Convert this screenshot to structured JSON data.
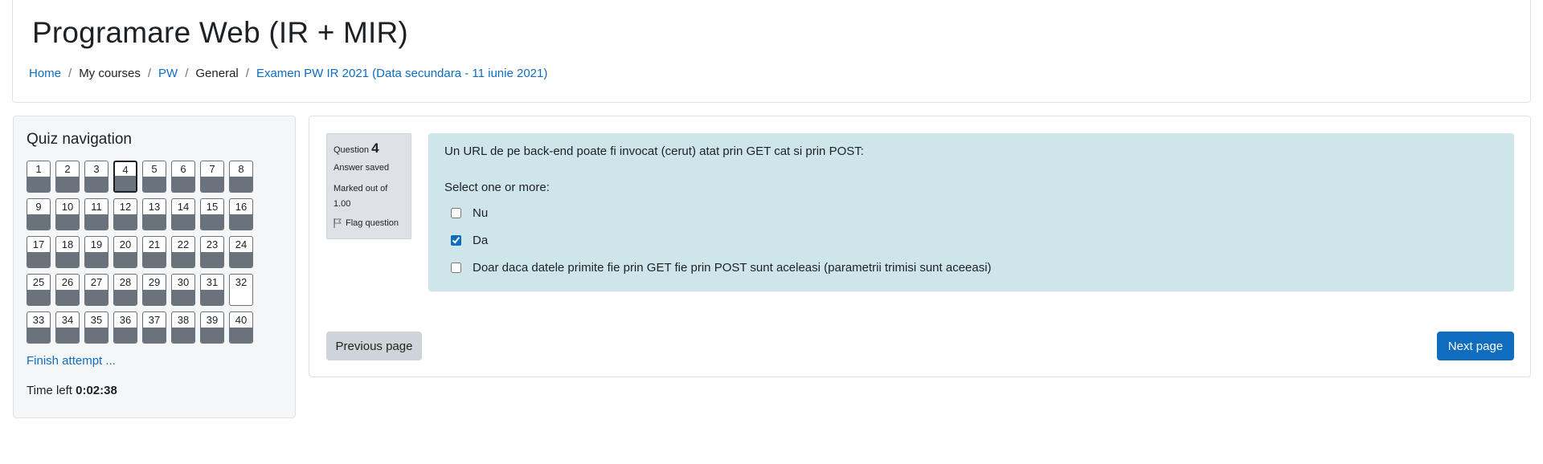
{
  "header": {
    "title": "Programare Web (IR + MIR)",
    "breadcrumb": [
      {
        "label": "Home",
        "link": true
      },
      {
        "label": "My courses",
        "link": false
      },
      {
        "label": "PW",
        "link": true
      },
      {
        "label": "General",
        "link": false
      },
      {
        "label": "Examen PW IR 2021 (Data secundara - 11 iunie 2021)",
        "link": true
      }
    ],
    "separator": "/"
  },
  "quiz_nav": {
    "title": "Quiz navigation",
    "current_question": 4,
    "questions": [
      {
        "n": "1",
        "answered": true
      },
      {
        "n": "2",
        "answered": true
      },
      {
        "n": "3",
        "answered": true
      },
      {
        "n": "4",
        "answered": true
      },
      {
        "n": "5",
        "answered": true
      },
      {
        "n": "6",
        "answered": true
      },
      {
        "n": "7",
        "answered": true
      },
      {
        "n": "8",
        "answered": true
      },
      {
        "n": "9",
        "answered": true
      },
      {
        "n": "10",
        "answered": true
      },
      {
        "n": "11",
        "answered": true
      },
      {
        "n": "12",
        "answered": true
      },
      {
        "n": "13",
        "answered": true
      },
      {
        "n": "14",
        "answered": true
      },
      {
        "n": "15",
        "answered": true
      },
      {
        "n": "16",
        "answered": true
      },
      {
        "n": "17",
        "answered": true
      },
      {
        "n": "18",
        "answered": true
      },
      {
        "n": "19",
        "answered": true
      },
      {
        "n": "20",
        "answered": true
      },
      {
        "n": "21",
        "answered": true
      },
      {
        "n": "22",
        "answered": true
      },
      {
        "n": "23",
        "answered": true
      },
      {
        "n": "24",
        "answered": true
      },
      {
        "n": "25",
        "answered": true
      },
      {
        "n": "26",
        "answered": true
      },
      {
        "n": "27",
        "answered": true
      },
      {
        "n": "28",
        "answered": true
      },
      {
        "n": "29",
        "answered": true
      },
      {
        "n": "30",
        "answered": true
      },
      {
        "n": "31",
        "answered": true
      },
      {
        "n": "32",
        "answered": false
      },
      {
        "n": "33",
        "answered": true
      },
      {
        "n": "34",
        "answered": true
      },
      {
        "n": "35",
        "answered": true
      },
      {
        "n": "36",
        "answered": true
      },
      {
        "n": "37",
        "answered": true
      },
      {
        "n": "38",
        "answered": true
      },
      {
        "n": "39",
        "answered": true
      },
      {
        "n": "40",
        "answered": true
      }
    ],
    "finish_link": "Finish attempt ...",
    "time_left_label": "Time left",
    "time_left_value": "0:02:38"
  },
  "question": {
    "label": "Question",
    "number": "4",
    "state": "Answer saved",
    "grade_label": "Marked out of",
    "grade_value": "1.00",
    "flag_label": "Flag question",
    "text": "Un URL de pe back-end poate fi invocat (cerut) atat prin GET cat si prin POST:",
    "prompt": "Select one or more:",
    "options": [
      {
        "label": "Nu",
        "checked": false
      },
      {
        "label": "Da",
        "checked": true
      },
      {
        "label": "Doar daca datele primite fie prin GET fie prin POST sunt aceleasi (parametrii trimisi sunt aceeasi)",
        "checked": false
      }
    ]
  },
  "buttons": {
    "previous": "Previous page",
    "next": "Next page"
  },
  "colors": {
    "link": "#0f6cbf",
    "question_bg": "#cee6e9",
    "answered_fill": "#6a737b",
    "primary_button": "#0f6cbf"
  }
}
